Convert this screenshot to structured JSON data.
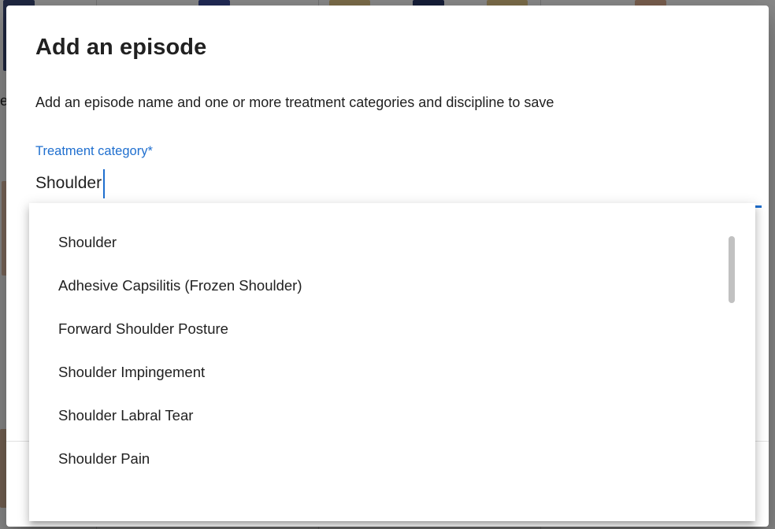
{
  "dialog": {
    "title": "Add an episode",
    "description": "Add an episode name and one or more treatment categories and discipline to save"
  },
  "treatment_field": {
    "label": "Treatment category*",
    "value": "Shoulder"
  },
  "dropdown": {
    "options": [
      "Shoulder",
      "Adhesive Capsilitis (Frozen Shoulder)",
      "Forward Shoulder Posture",
      "Shoulder Impingement",
      "Shoulder Labral Tear",
      "Shoulder Pain"
    ]
  },
  "background": {
    "partial_letter": "e"
  },
  "colors": {
    "accent": "#1f6fcf",
    "text_primary": "#212121",
    "overlay": "rgba(0,0,0,0.46)"
  }
}
